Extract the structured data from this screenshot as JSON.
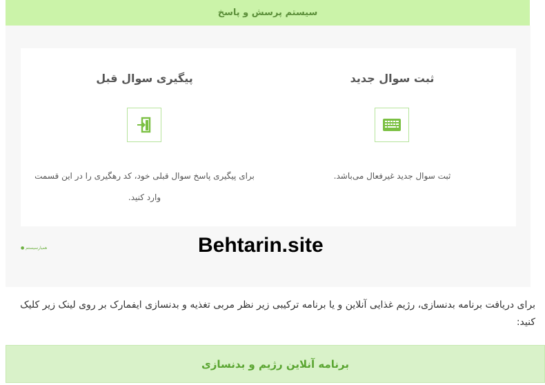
{
  "header": {
    "title": "سیستم پرسش و پاسخ"
  },
  "cards": {
    "new_question": {
      "title": "ثبت سوال جدید",
      "icon": "keyboard-icon",
      "description": "ثبت سوال جدید غیرفعال می‌باشد."
    },
    "follow_up": {
      "title": "پیگیری سوال قبل",
      "icon": "sign-in-icon",
      "description": "برای پیگیری پاسخ سوال قبلی خود، کد رهگیری را در این قسمت وارد کنید."
    }
  },
  "watermark": {
    "small": "● همیارسیستم",
    "big": "Behtarin.site"
  },
  "paragraph": "برای دریافت برنامه بدنسازی، رژیم غذایی آنلاین و یا برنامه ترکیبی زیر نظر مربی تغذیه و بدنسازی ایفمارک بر روی لینک زیر کلیک کنید:",
  "cta": {
    "label": "برنامه آنلاین رژیم و بدنسازی"
  },
  "colors": {
    "accent": "#7bc043",
    "header_bg": "#cbf3a9",
    "cta_bg": "#d9f2c9"
  }
}
